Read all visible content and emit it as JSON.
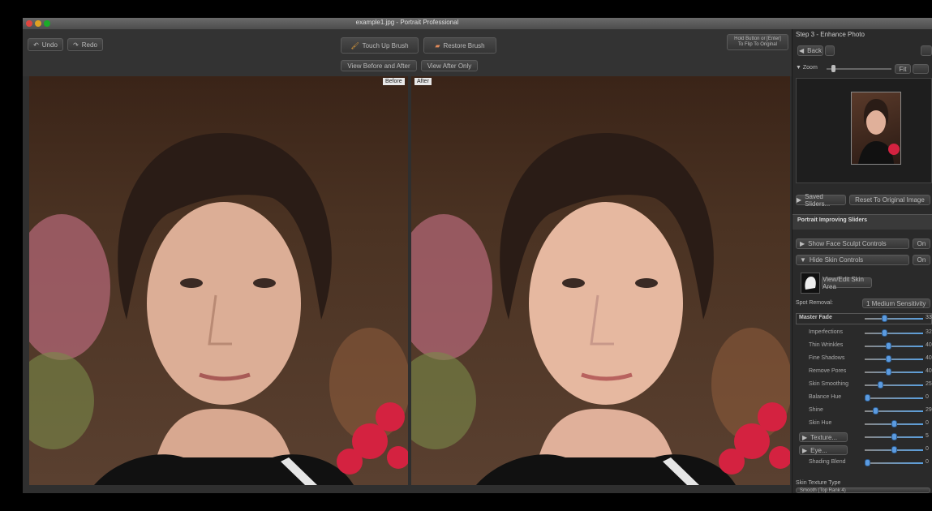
{
  "window": {
    "title": "example1.jpg - Portrait Professional"
  },
  "toolbar": {
    "undo": "Undo",
    "redo": "Redo",
    "touch_up": "Touch Up Brush",
    "restore": "Restore Brush",
    "view_before_after": "View Before and After",
    "view_after_only": "View After Only",
    "hint_line1": "Hold Button or [Enter]",
    "hint_line2": "To Flip To Original"
  },
  "photos": {
    "before_label": "Before",
    "after_label": "After"
  },
  "panel": {
    "step_title": "Step 3 - Enhance Photo",
    "back": "Back",
    "zoom": "Zoom",
    "fit": "Fit",
    "save_sliders": "Saved Sliders...",
    "reset": "Reset To Original Image",
    "section_title": "Portrait Improving Sliders",
    "show_face": "Show Face Sculpt Controls",
    "hide_skin": "Hide Skin Controls",
    "on": "On",
    "view_skin_area": "View/Edit Skin Area",
    "spot_label": "Spot Removal:",
    "spot_value": "1 Medium Sensitivity",
    "master_label": "Master Fade",
    "master_value": "33",
    "sliders": [
      {
        "label": "Imperfections",
        "value": "32",
        "pos": 0.32
      },
      {
        "label": "Thin Wrinkles",
        "value": "40",
        "pos": 0.4
      },
      {
        "label": "Fine Shadows",
        "value": "40",
        "pos": 0.4
      },
      {
        "label": "Remove Pores",
        "value": "40",
        "pos": 0.4
      },
      {
        "label": "Skin Smoothing",
        "value": "25",
        "pos": 0.25
      },
      {
        "label": "Balance Hue",
        "value": "0",
        "pos": 0.0
      },
      {
        "label": "Shine",
        "value": "29",
        "pos": 0.15
      },
      {
        "label": "Skin Hue",
        "value": "0",
        "pos": 0.5
      },
      {
        "label": "Texture...",
        "value": "5",
        "pos": 0.5
      },
      {
        "label": "Eye...",
        "value": "0",
        "pos": 0.5
      },
      {
        "label": "Shading Blend",
        "value": "0",
        "pos": 0.0
      }
    ],
    "texture_type_label": "Skin Texture Type",
    "texture_type_value": "Smooth (Top Rank 4)"
  },
  "colors": {
    "accent": "#5b9be0",
    "background": "#2f2f2f"
  }
}
